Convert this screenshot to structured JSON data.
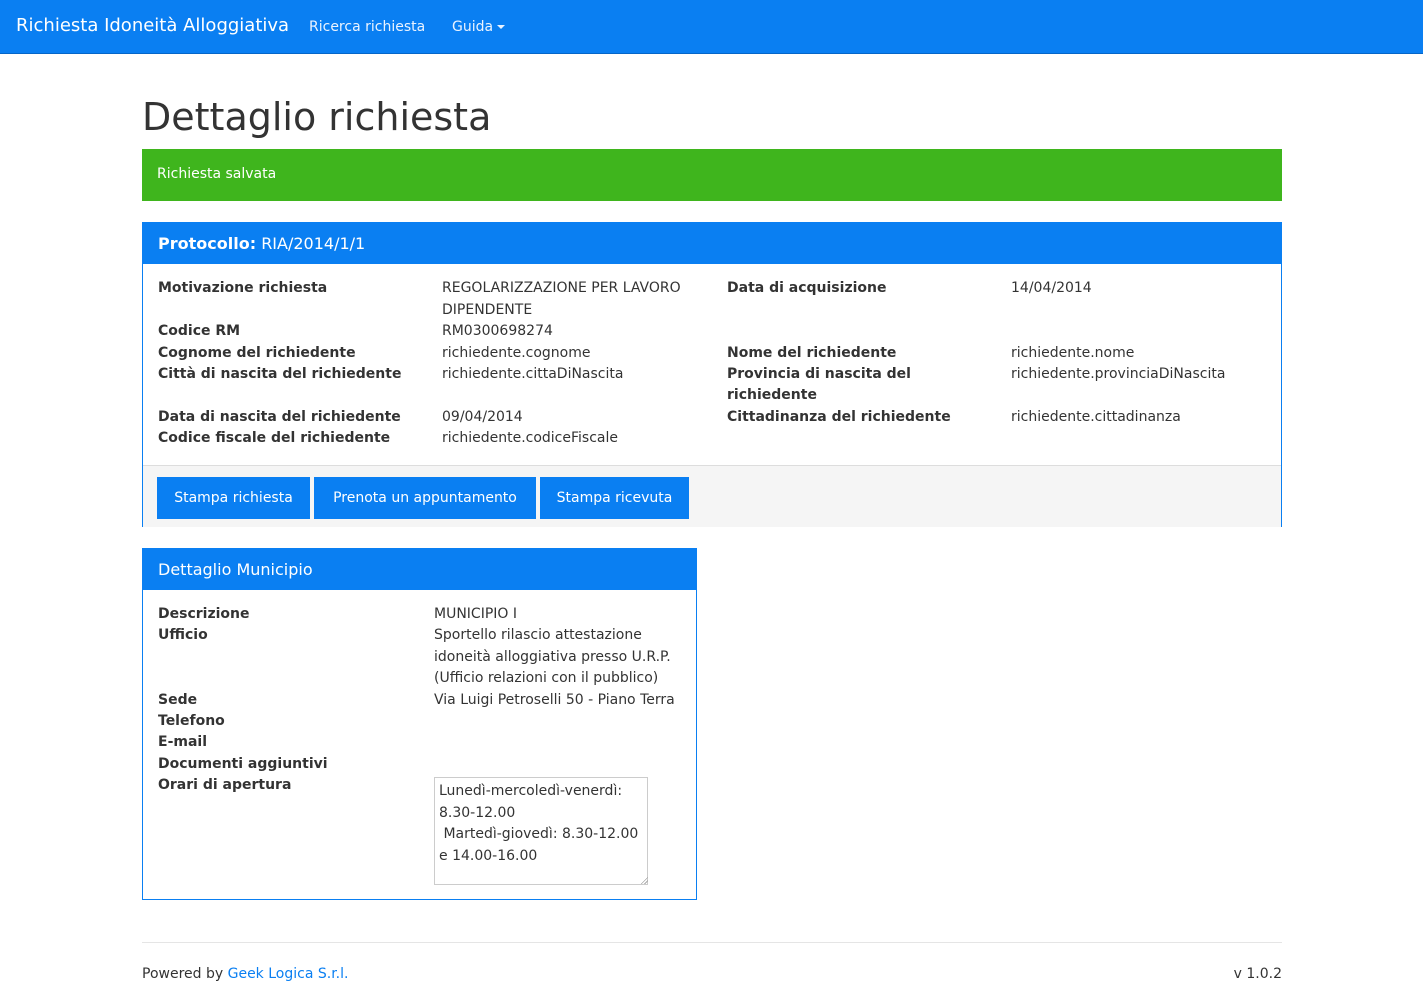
{
  "navbar": {
    "brand": "Richiesta Idoneità Alloggiativa",
    "links": [
      "Ricerca richiesta",
      "Guida"
    ]
  },
  "page_title": "Dettaglio richiesta",
  "alert": "Richiesta salvata",
  "request_panel": {
    "heading_label": "Protocollo:",
    "heading_value": "RIA/2014/1/1",
    "fields": {
      "motivazione_label": "Motivazione richiesta",
      "motivazione_value_line1": "REGOLARIZZAZIONE PER LAVORO",
      "motivazione_value_line2": "DIPENDENTE",
      "data_acquisizione_label": "Data di acquisizione",
      "data_acquisizione_value": "14/04/2014",
      "codice_rm_label": "Codice RM",
      "codice_rm_value": "RM0300698274",
      "cognome_label": "Cognome del richiedente",
      "cognome_value": "richiedente.cognome",
      "nome_label": "Nome del richiedente",
      "nome_value": "richiedente.nome",
      "citta_label": "Città di nascita del richiedente",
      "citta_value": "richiedente.cittaDiNascita",
      "provincia_label_line1": "Provincia di nascita del",
      "provincia_label_line2": "richiedente",
      "provincia_value": "richiedente.provinciaDiNascita",
      "data_nascita_label": "Data di nascita del richiedente",
      "data_nascita_value": "09/04/2014",
      "cittadinanza_label": "Cittadinanza del richiedente",
      "cittadinanza_value": "richiedente.cittadinanza",
      "codice_fiscale_label": "Codice fiscale del richiedente",
      "codice_fiscale_value": "richiedente.codiceFiscale"
    },
    "buttons": [
      "Stampa richiesta",
      "Prenota un appuntamento",
      "Stampa ricevuta"
    ]
  },
  "municipio_panel": {
    "heading": "Dettaglio Municipio",
    "descrizione_label": "Descrizione",
    "descrizione_value": "MUNICIPIO I",
    "ufficio_label": "Ufficio",
    "ufficio_value_line1": "Sportello rilascio attestazione",
    "ufficio_value_line2": "idoneità alloggiativa presso U.R.P.",
    "ufficio_value_line3": "(Ufficio relazioni con il pubblico)",
    "sede_label": "Sede",
    "sede_value": "Via Luigi Petroselli 50 - Piano Terra",
    "telefono_label": "Telefono",
    "email_label": "E-mail",
    "documenti_label": "Documenti aggiuntivi",
    "orari_label": "Orari di apertura",
    "orari_value": "Lunedì-mercoledì-venerdì: 8.30-12.00\n Martedì-giovedì: 8.30-12.00 e 14.00-16.00"
  },
  "footer": {
    "powered_by": "Powered by",
    "company": "Geek Logica S.r.l.",
    "version": "v 1.0.2"
  },
  "colors": {
    "primary": "#0a7ff2",
    "success": "#3fb51d"
  }
}
